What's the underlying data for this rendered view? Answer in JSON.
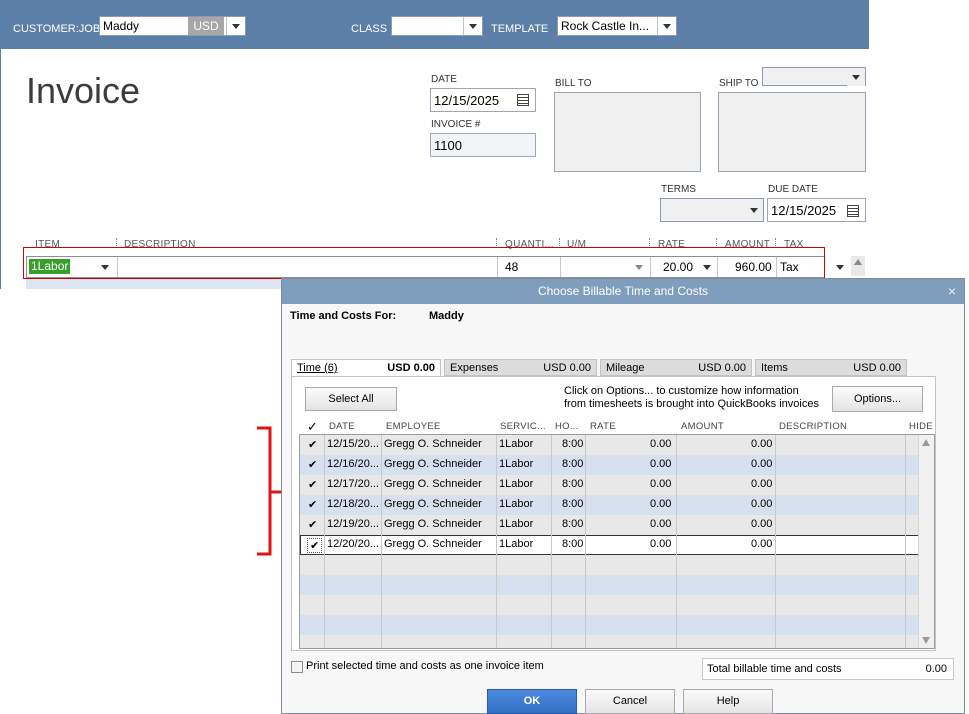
{
  "invoice_header": {
    "customer_job_label": "CUSTOMER:JOB",
    "customer_value": "Maddy",
    "currency": "USD",
    "class_label": "CLASS",
    "class_value": "",
    "template_label": "TEMPLATE",
    "template_value": "Rock Castle In...",
    "accent_color": "#5b7fa6"
  },
  "invoice_form": {
    "title": "Invoice",
    "date_label": "DATE",
    "date_value": "12/15/2025",
    "invoice_no_label": "INVOICE #",
    "invoice_no_value": "1100",
    "bill_to_label": "BILL TO",
    "ship_to_label": "SHIP TO",
    "terms_label": "TERMS",
    "due_date_label": "DUE DATE",
    "due_date_value": "12/15/2025"
  },
  "line_items": {
    "columns": [
      "ITEM",
      "DESCRIPTION",
      "QUANTI...",
      "U/M",
      "RATE",
      "AMOUNT",
      "TAX"
    ],
    "row": {
      "item": "1Labor",
      "description": "",
      "quantity": "48",
      "um": "",
      "rate": "20.00",
      "amount": "960.00",
      "tax": "Tax"
    },
    "highlight_color": "#d40000"
  },
  "dialog": {
    "title": "Choose Billable Time and Costs",
    "close_glyph": "×",
    "for_label": "Time and Costs For:",
    "for_value": "Maddy",
    "tabs": [
      {
        "label": "Time (6)",
        "amount": "USD 0.00"
      },
      {
        "label": "Expenses",
        "amount": "USD 0.00"
      },
      {
        "label": "Mileage",
        "amount": "USD 0.00"
      },
      {
        "label": "Items",
        "amount": "USD 0.00"
      }
    ],
    "select_all_label": "Select All",
    "options_hint": "Click on Options... to customize how information from timesheets is brought into QuickBooks invoices",
    "options_label": "Options...",
    "grid_columns": [
      "✓",
      "DATE",
      "EMPLOYEE",
      "SERVIC...",
      "HO...",
      "RATE",
      "AMOUNT",
      "DESCRIPTION",
      "HIDE"
    ],
    "rows": [
      {
        "check": "✔",
        "date": "12/15/20...",
        "employee": "Gregg O. Schneider",
        "service": "1Labor",
        "hours": "8:00",
        "rate": "0.00",
        "amount": "0.00",
        "description": ""
      },
      {
        "check": "✔",
        "date": "12/16/20...",
        "employee": "Gregg O. Schneider",
        "service": "1Labor",
        "hours": "8:00",
        "rate": "0.00",
        "amount": "0.00",
        "description": ""
      },
      {
        "check": "✔",
        "date": "12/17/20...",
        "employee": "Gregg O. Schneider",
        "service": "1Labor",
        "hours": "8:00",
        "rate": "0.00",
        "amount": "0.00",
        "description": ""
      },
      {
        "check": "✔",
        "date": "12/18/20...",
        "employee": "Gregg O. Schneider",
        "service": "1Labor",
        "hours": "8:00",
        "rate": "0.00",
        "amount": "0.00",
        "description": ""
      },
      {
        "check": "✔",
        "date": "12/19/20...",
        "employee": "Gregg O. Schneider",
        "service": "1Labor",
        "hours": "8:00",
        "rate": "0.00",
        "amount": "0.00",
        "description": ""
      },
      {
        "check": "✔",
        "date": "12/20/20...",
        "employee": "Gregg O. Schneider",
        "service": "1Labor",
        "hours": "8:00",
        "rate": "0.00",
        "amount": "0.00",
        "description": ""
      }
    ],
    "print_label": "Print selected time and costs as one invoice item",
    "total_label": "Total billable time and costs",
    "total_value": "0.00",
    "ok_label": "OK",
    "cancel_label": "Cancel",
    "help_label": "Help",
    "ok_color": "#2f6fc4",
    "bracket_color": "#e01515"
  }
}
